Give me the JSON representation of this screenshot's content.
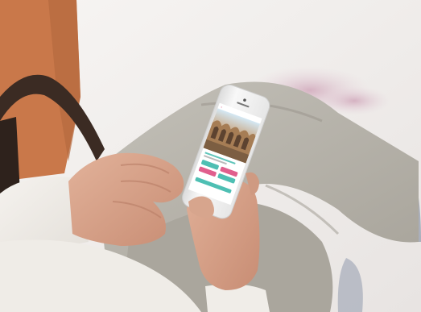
{
  "scene": {
    "description_visible_text": "",
    "colors": {
      "wall": "#ece8e6",
      "pink_stain": "#d8b9c6",
      "orange_cushion": "#c77a4a",
      "chair_wood": "#3a2a22",
      "pants_gray": "#b9b6ad",
      "sweater_white": "#f1eee8",
      "skin": "#d9a48b",
      "skin_shadow": "#c48a72",
      "phone_body": "#f4f4f4",
      "phone_bezel": "#e9e9e9",
      "phone_screen_bg": "#ffffff",
      "app_teal": "#4ebfb3",
      "app_pink": "#e05f8d",
      "image_sky": "#cfe5f3",
      "image_stone": "#b08a63"
    }
  },
  "phone": {
    "status_bar": "",
    "app_ui": {
      "header_icon": "back-arrow-icon",
      "progress_segments": 6,
      "buttons": [
        {
          "color": "teal"
        },
        {
          "color": "pink"
        },
        {
          "color": "pink"
        },
        {
          "color": "teal"
        }
      ]
    }
  }
}
